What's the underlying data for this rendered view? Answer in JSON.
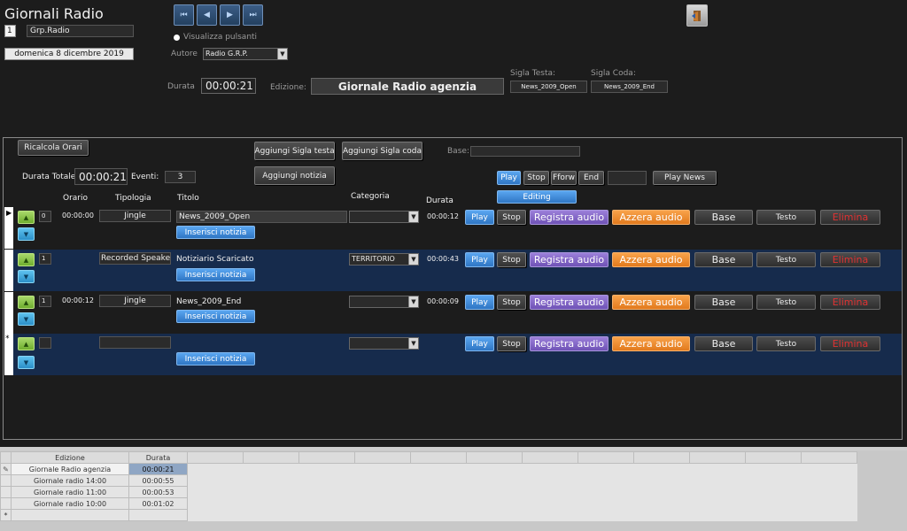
{
  "title": "Giornali Radio",
  "header": {
    "id": "1",
    "group": "Grp.Radio",
    "date": "domenica 8 dicembre 2019",
    "show_buttons_label": "Visualizza pulsanti",
    "author_label": "Autore",
    "author_value": "Radio G.R.P.",
    "duration_label": "Durata",
    "duration_value": "00:00:21",
    "edition_label": "Edizione:",
    "edition_value": "Giornale Radio agenzia",
    "head_jingle_label": "Sigla Testa:",
    "head_jingle_value": "News_2009_Open",
    "tail_jingle_label": "Sigla Coda:",
    "tail_jingle_value": "News_2009_End"
  },
  "toolbar": {
    "recalc": "Ricalcola Orari",
    "add_head": "Aggiungi Sigla testa",
    "add_tail": "Aggiungi Sigla coda",
    "add_news": "Aggiungi notizia",
    "base_label": "Base:",
    "total_label": "Durata Totale",
    "total_value": "00:00:21",
    "events_label": "Eventi:",
    "events_value": "3",
    "play": "Play",
    "stop": "Stop",
    "fforw": "Fforw",
    "end": "End",
    "play_news": "Play News",
    "editing": "Editing"
  },
  "columns": {
    "orario": "Orario",
    "tipologia": "Tipologia",
    "titolo": "Titolo",
    "categoria": "Categoria",
    "durata": "Durata"
  },
  "row_buttons": {
    "insert": "Inserisci notizia",
    "play": "Play",
    "stop": "Stop",
    "record": "Registra audio",
    "reset": "Azzera audio",
    "base": "Base",
    "text": "Testo",
    "delete": "Elimina"
  },
  "rows": [
    {
      "num": "0",
      "orario": "00:00:00",
      "tipologia": "Jingle",
      "titolo": "News_2009_Open",
      "categoria": "",
      "durata": "00:00:12"
    },
    {
      "num": "1",
      "orario": "",
      "tipologia": "Recorded Speaker",
      "titolo": "Notiziario Scaricato",
      "categoria": "TERRITORIO",
      "durata": "00:00:43"
    },
    {
      "num": "1",
      "orario": "00:00:12",
      "tipologia": "Jingle",
      "titolo": "News_2009_End",
      "categoria": "",
      "durata": "00:00:09"
    },
    {
      "num": "",
      "orario": "",
      "tipologia": "",
      "titolo": "",
      "categoria": "",
      "durata": ""
    }
  ],
  "datasheet": {
    "headers": [
      "Edizione",
      "Durata"
    ],
    "rows": [
      [
        "Giornale Radio agenzia",
        "00:00:21"
      ],
      [
        "Giornale radio 14:00",
        "00:00:55"
      ],
      [
        "Giornale radio 11:00",
        "00:00:53"
      ],
      [
        "Giornale radio 10:00",
        "00:01:02"
      ]
    ]
  },
  "icons": {
    "nav": [
      "first-record-icon",
      "previous-record-icon",
      "next-record-icon",
      "last-record-icon"
    ],
    "exit": "exit-door-icon"
  }
}
